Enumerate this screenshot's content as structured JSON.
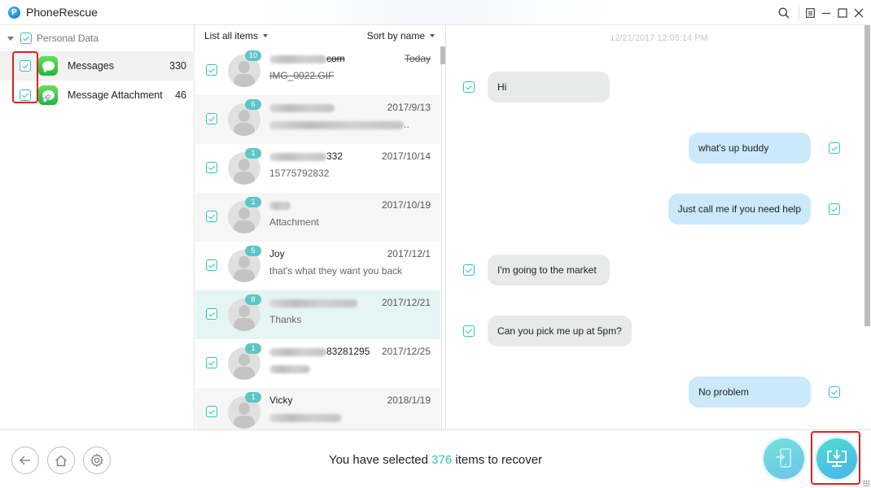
{
  "window": {
    "title": "PhoneRescue",
    "logo_glyph": "P",
    "controls": [
      "search-icon",
      "menu-icon",
      "minimize-icon",
      "maximize-icon",
      "close-icon"
    ]
  },
  "sidebar": {
    "category": {
      "label": "Personal Data",
      "checked": true,
      "expanded": true
    },
    "items": [
      {
        "label": "Messages",
        "count": "330",
        "checked": true,
        "active": true,
        "icon": "messages-app-icon"
      },
      {
        "label": "Message Attachment",
        "count": "46",
        "checked": true,
        "active": false,
        "icon": "message-attachment-icon"
      }
    ]
  },
  "list": {
    "filter_label": "List all items",
    "sort_label": "Sort by name",
    "contacts": [
      {
        "badge": "10",
        "name_visible": "com",
        "name_blurred": true,
        "preview": "IMG_0022.GIF",
        "date": "Today",
        "deleted": true,
        "checked": true,
        "state": "normal"
      },
      {
        "badge": "6",
        "name_visible": "",
        "name_blurred": true,
        "preview": "..",
        "preview_blurred": true,
        "date": "2017/9/13",
        "deleted": false,
        "checked": true,
        "state": "alt"
      },
      {
        "badge": "1",
        "name_visible": "332",
        "name_blurred": true,
        "preview": "15775792832",
        "date": "2017/10/14",
        "deleted": false,
        "checked": true,
        "state": "normal"
      },
      {
        "badge": "1",
        "name_visible": "",
        "name_blurred": true,
        "preview": "Attachment",
        "date": "2017/10/19",
        "deleted": false,
        "checked": true,
        "state": "alt"
      },
      {
        "badge": "5",
        "name_visible": "Joy",
        "name_blurred": false,
        "preview": "that's what they want you back",
        "date": "2017/12/1",
        "deleted": false,
        "checked": true,
        "state": "normal"
      },
      {
        "badge": "8",
        "name_visible": "",
        "name_blurred": true,
        "preview": "Thanks",
        "date": "2017/12/21",
        "deleted": false,
        "checked": true,
        "state": "selected"
      },
      {
        "badge": "1",
        "name_visible": "83281295",
        "name_blurred": true,
        "preview": "",
        "preview_blurred": true,
        "date": "2017/12/25",
        "deleted": false,
        "checked": true,
        "state": "normal"
      },
      {
        "badge": "1",
        "name_visible": "Vicky",
        "name_blurred": false,
        "preview": "",
        "preview_blurred": true,
        "date": "2018/1/19",
        "deleted": false,
        "checked": true,
        "state": "alt"
      }
    ]
  },
  "chat": {
    "timestamp": "12/21/2017 12:05:14 PM",
    "messages": [
      {
        "text": "Hi",
        "direction": "incoming",
        "checked": true
      },
      {
        "text": "what's up buddy",
        "direction": "outgoing",
        "checked": true
      },
      {
        "text": "Just call me if you need help",
        "direction": "outgoing",
        "checked": true
      },
      {
        "text": "I'm going to the market",
        "direction": "incoming",
        "checked": true
      },
      {
        "text": "Can you pick me up at 5pm?",
        "direction": "incoming",
        "checked": true
      },
      {
        "text": "No problem",
        "direction": "outgoing",
        "checked": true
      }
    ]
  },
  "footer": {
    "status_prefix": "You have selected ",
    "selected_count": "376",
    "status_suffix": " items to recover",
    "buttons": {
      "back": "back-icon",
      "home": "home-icon",
      "settings": "gear-icon",
      "to_device": "recover-to-device-icon",
      "to_computer": "recover-to-computer-icon"
    }
  },
  "colors": {
    "accent": "#2ec4b6",
    "badge": "#5fc6c6",
    "incoming_bubble": "#e8eaea",
    "outgoing_bubble": "#cbe9fb",
    "highlight_box": "#e02020",
    "selected_row": "#e4f5f3"
  }
}
